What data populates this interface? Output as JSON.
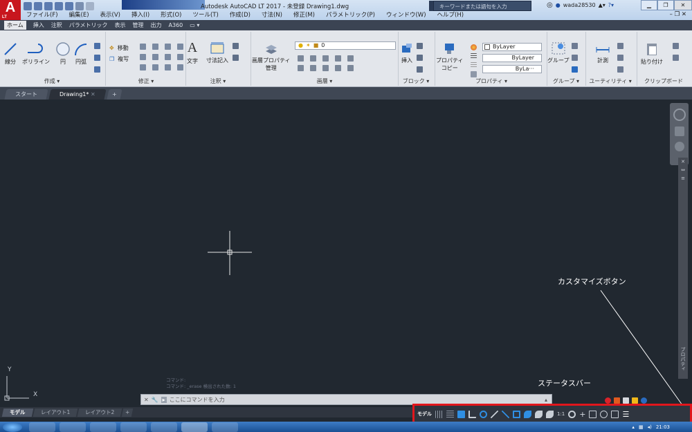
{
  "window": {
    "title": "Autodesk AutoCAD LT 2017 - 未登録  Drawing1.dwg",
    "search_placeholder": "キーワードまたは語句を入力",
    "username": "wada28530",
    "app_logo": "A",
    "app_edition": "LT"
  },
  "menubar": [
    "ファイル(F)",
    "編集(E)",
    "表示(V)",
    "挿入(I)",
    "形式(O)",
    "ツール(T)",
    "作成(D)",
    "寸法(N)",
    "修正(M)",
    "パラメトリック(P)",
    "ウィンドウ(W)",
    "ヘルプ(H)"
  ],
  "ribbon_tabs": [
    "ホーム",
    "挿入",
    "注釈",
    "パラメトリック",
    "表示",
    "管理",
    "出力",
    "A360"
  ],
  "ribbon": {
    "draw": {
      "line": "線分",
      "polyline": "ポリライン",
      "circle": "円",
      "arc": "円弧",
      "label": "作成 ▾"
    },
    "modify": {
      "move": "移動",
      "copy": "複写",
      "label": "修正 ▾"
    },
    "annotation": {
      "text": "文字",
      "dimension": "寸法記入",
      "label": "注釈 ▾"
    },
    "layers": {
      "layer_props_1": "画層プロパティ",
      "layer_props_2": "管理",
      "current_layer": "0",
      "label": "画層 ▾"
    },
    "block": {
      "insert": "挿入",
      "label": "ブロック ▾"
    },
    "properties": {
      "match_1": "プロパティ",
      "match_2": "コピー",
      "color": "ByLayer",
      "linetype": "ByLayer",
      "lineweight": "ByLa···",
      "label": "プロパティ ▾"
    },
    "groups": {
      "group": "グループ",
      "label": "グループ ▾"
    },
    "utilities": {
      "measure": "計測",
      "label": "ユーティリティ ▾"
    },
    "clipboard": {
      "paste": "貼り付け",
      "label": "クリップボード"
    }
  },
  "doc_tabs": [
    "スタート",
    "Drawing1*"
  ],
  "drawing": {
    "ucs_x": "X",
    "ucs_y": "Y",
    "properties_panel": "プロパティ"
  },
  "callouts": {
    "customize_button": "カスタマイズボタン",
    "status_bar": "ステータスバー"
  },
  "command": {
    "history_1": "コマンド:",
    "history_2": "コマンド: _erase 検出された数: 1",
    "placeholder": "ここにコマンドを入力"
  },
  "layout_tabs": [
    "モデル",
    "レイアウト1",
    "レイアウト2"
  ],
  "statusbar": {
    "model": "モデル",
    "scale": "1:1"
  },
  "taskbar": {
    "time": "21:03"
  },
  "colors": {
    "canvas": "#212830",
    "highlight": "#e2161c",
    "ribbon": "#e3e6eb"
  }
}
